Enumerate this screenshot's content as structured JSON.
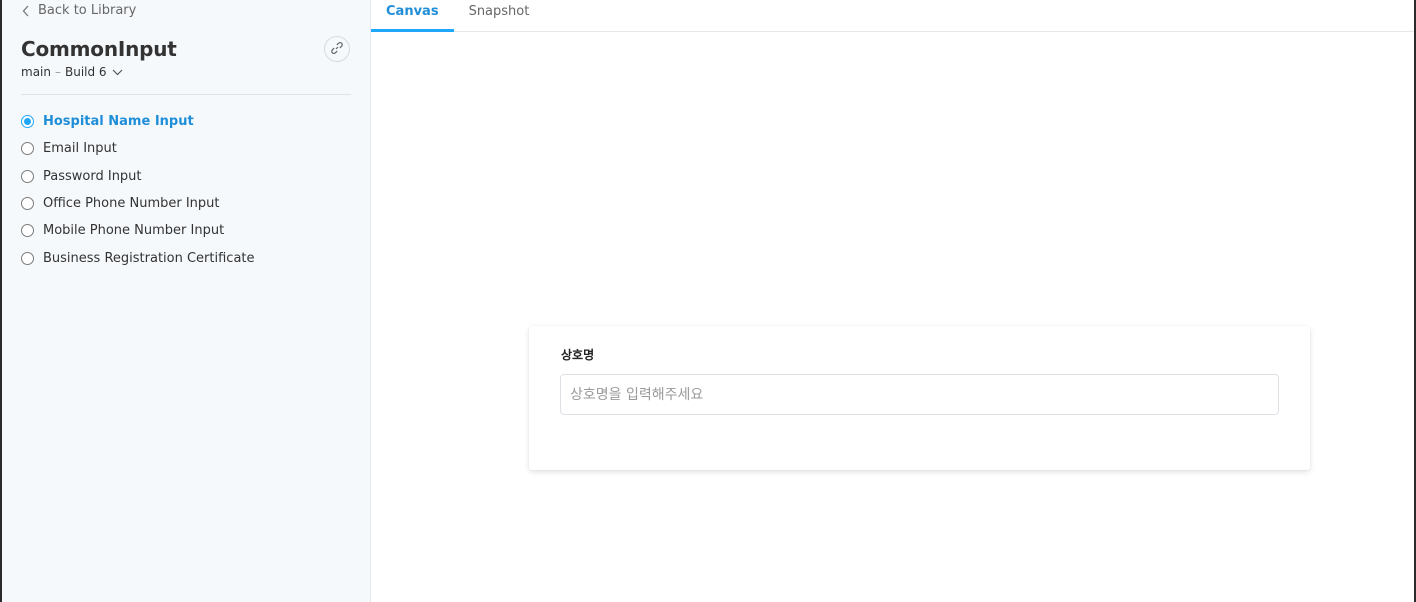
{
  "sidebar": {
    "back_label": "Back to Library",
    "component_title": "CommonInput",
    "branch": "main",
    "separator": "–",
    "build": "Build 6",
    "stories": [
      {
        "label": "Hospital Name Input",
        "active": true
      },
      {
        "label": "Email Input",
        "active": false
      },
      {
        "label": "Password Input",
        "active": false
      },
      {
        "label": "Office Phone Number Input",
        "active": false
      },
      {
        "label": "Mobile Phone Number Input",
        "active": false
      },
      {
        "label": "Business Registration Certificate",
        "active": false
      }
    ]
  },
  "tabs": [
    {
      "label": "Canvas",
      "active": true
    },
    {
      "label": "Snapshot",
      "active": false
    }
  ],
  "canvas": {
    "field_label": "상호명",
    "input_value": "",
    "input_placeholder": "상호명을 입력해주세요"
  },
  "icons": {
    "back": "chevron-left-icon",
    "link": "link-icon",
    "build_dropdown": "chevron-down-icon"
  },
  "colors": {
    "accent": "#1ea7fd",
    "active_text": "#1f8ed8",
    "sidebar_bg": "#f6f9fc"
  }
}
